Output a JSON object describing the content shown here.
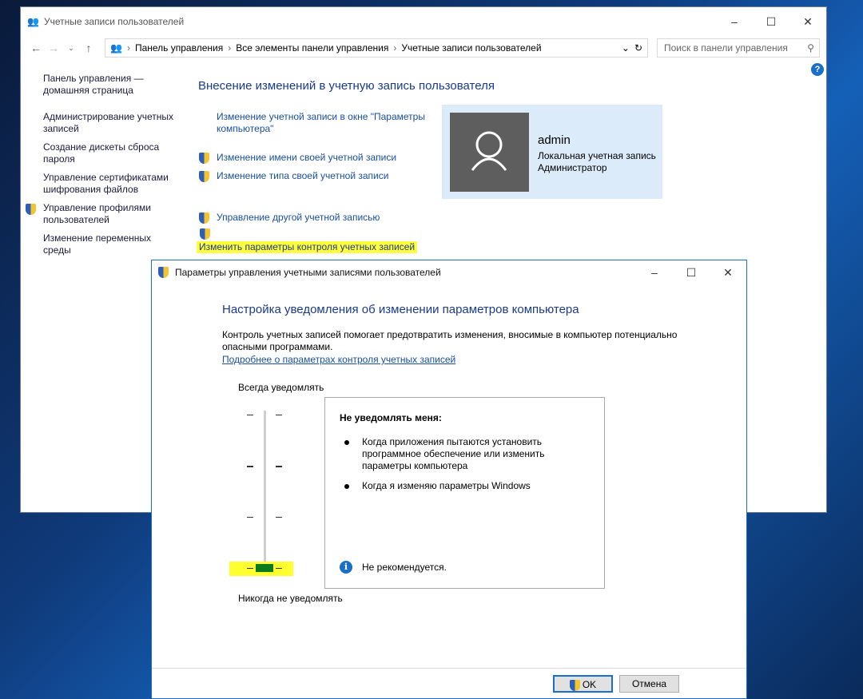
{
  "main_window": {
    "title": "Учетные записи пользователей",
    "breadcrumb": [
      "Панель управления",
      "Все элементы панели управления",
      "Учетные записи пользователей"
    ],
    "search_placeholder": "Поиск в панели управления",
    "sidebar": [
      "Панель управления — домашняя страница",
      "Администрирование учетных записей",
      "Создание дискеты сброса пароля",
      "Управление сертификатами шифрования файлов",
      "Управление профилями пользователей",
      "Изменение переменных среды"
    ],
    "heading": "Внесение изменений в учетную запись пользователя",
    "links": [
      "Изменение учетной записи в окне \"Параметры компьютера\"",
      "Изменение имени своей учетной записи",
      "Изменение типа своей учетной записи",
      "Управление другой учетной записью",
      "Изменить параметры контроля учетных записей"
    ],
    "user": {
      "name": "admin",
      "type": "Локальная учетная запись",
      "role": "Администратор"
    }
  },
  "dialog": {
    "title": "Параметры управления учетными записями пользователей",
    "heading": "Настройка уведомления об изменении параметров компьютера",
    "description": "Контроль учетных записей помогает предотвратить изменения, вносимые в компьютер потенциально опасными программами.",
    "link": "Подробнее о параметрах контроля учетных записей",
    "top_label": "Всегда уведомлять",
    "bottom_label": "Никогда не уведомлять",
    "slider_level": 0,
    "slider_max": 3,
    "box_title": "Не уведомлять меня:",
    "bullets": [
      "Когда приложения пытаются установить программное обеспечение или изменить параметры компьютера",
      "Когда я изменяю параметры Windows"
    ],
    "note": "Не рекомендуется.",
    "ok": "OK",
    "cancel": "Отмена"
  }
}
